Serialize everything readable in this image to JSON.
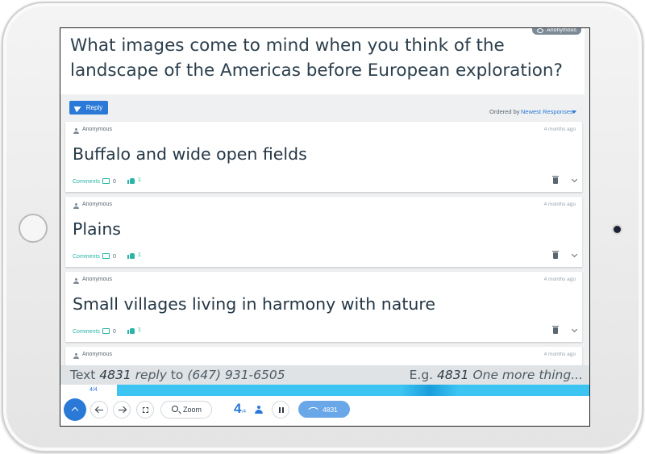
{
  "question": {
    "text": "What images come to mind when you think of the landscape of the Americas before European exploration?",
    "anon_chip": "Anonymous"
  },
  "toolbar": {
    "reply_label": "Reply",
    "ordered_by_label": "Ordered by",
    "ordered_by_value": "Newest Responses"
  },
  "responses": [
    {
      "author": "Anonymous",
      "time": "4 months ago",
      "body": "Buffalo and wide open fields",
      "comments_label": "Comments",
      "comments_count": "0",
      "likes": "1"
    },
    {
      "author": "Anonymous",
      "time": "4 months ago",
      "body": "Plains",
      "comments_label": "Comments",
      "comments_count": "0",
      "likes": "1"
    },
    {
      "author": "Anonymous",
      "time": "4 months ago",
      "body": "Small villages living in harmony with nature",
      "comments_label": "Comments",
      "comments_count": "0",
      "likes": "1"
    },
    {
      "author": "Anonymous",
      "time": "4 months ago"
    }
  ],
  "sms_bar": {
    "text_word": "Text",
    "code": "4831",
    "reply_word": "reply",
    "to_word": "to",
    "phone": "(647) 931-6505",
    "example_prefix": "E.g.",
    "example_code": "4831",
    "example_text": "One more thing..."
  },
  "progress": {
    "label": "4/4",
    "fraction": 0.9
  },
  "controls": {
    "zoom_label": "Zoom",
    "response_count": "4",
    "response_total": "/4",
    "code_pill": "4831"
  },
  "colors": {
    "accent": "#2b79d6",
    "teal": "#2bb5a8",
    "progress": "#3cc4f2"
  }
}
